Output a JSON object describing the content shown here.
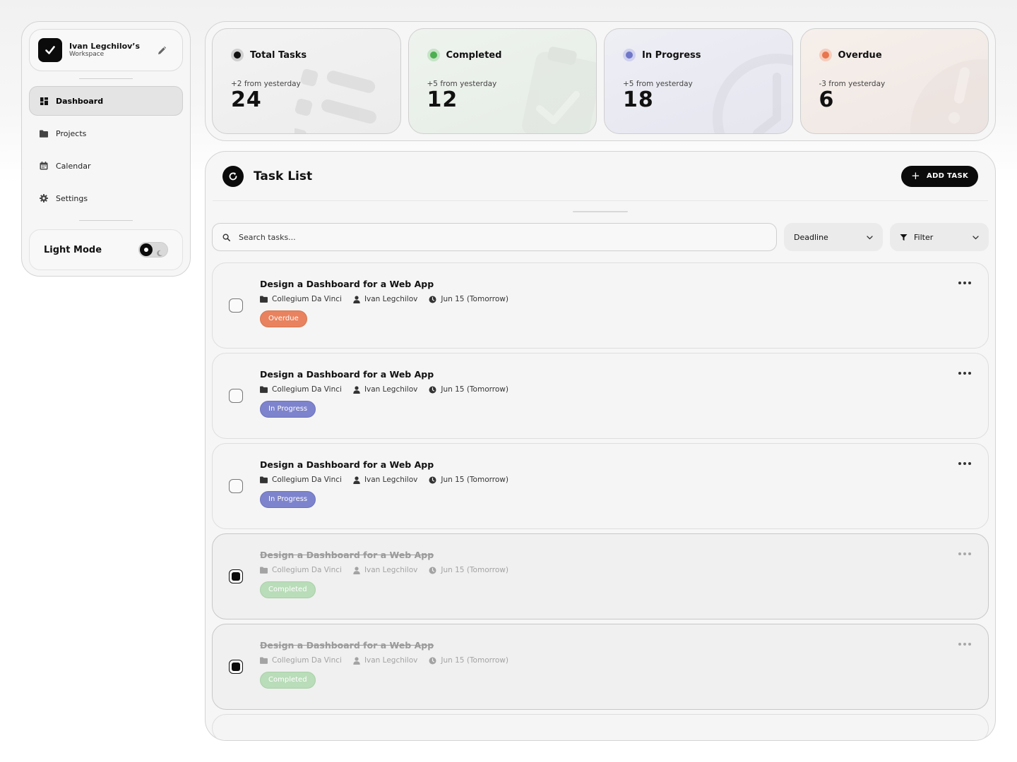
{
  "workspace": {
    "name": "Ivan Legchilov’s",
    "subtitle": "Workspace"
  },
  "nav": [
    {
      "label": "Dashboard",
      "icon": "dashboard-icon",
      "active": true
    },
    {
      "label": "Projects",
      "icon": "folder-icon",
      "active": false
    },
    {
      "label": "Calendar",
      "icon": "calendar-icon",
      "active": false
    },
    {
      "label": "Settings",
      "icon": "gear-icon",
      "active": false
    }
  ],
  "mode": {
    "label": "Light Mode"
  },
  "stats": [
    {
      "label": "Total Tasks",
      "delta": "+2 from yesterday",
      "value": "24",
      "color": "#111111"
    },
    {
      "label": "Completed",
      "delta": "+5 from yesterday",
      "value": "12",
      "color": "#4caf50"
    },
    {
      "label": "In Progress",
      "delta": "+5 from yesterday",
      "value": "18",
      "color": "#7077c9"
    },
    {
      "label": "Overdue",
      "delta": "-3 from yesterday",
      "value": "6",
      "color": "#e8754d"
    }
  ],
  "task_list": {
    "title": "Task List",
    "add_label": "ADD TASK",
    "search_placeholder": "Search tasks...",
    "sort_label": "Deadline",
    "filter_label": "Filter"
  },
  "tasks": [
    {
      "title": "Design a Dashboard for a Web App",
      "project": "Collegium Da Vinci",
      "assignee": "Ivan Legchilov",
      "due": "Jun 15 (Tomorrow)",
      "status": "Overdue",
      "done": false
    },
    {
      "title": "Design a Dashboard for a Web App",
      "project": "Collegium Da Vinci",
      "assignee": "Ivan Legchilov",
      "due": "Jun 15 (Tomorrow)",
      "status": "In Progress",
      "done": false
    },
    {
      "title": "Design a Dashboard for a Web App",
      "project": "Collegium Da Vinci",
      "assignee": "Ivan Legchilov",
      "due": "Jun 15 (Tomorrow)",
      "status": "In Progress",
      "done": false
    },
    {
      "title": "Design a Dashboard for a Web App",
      "project": "Collegium Da Vinci",
      "assignee": "Ivan Legchilov",
      "due": "Jun 15 (Tomorrow)",
      "status": "Completed",
      "done": true
    },
    {
      "title": "Design a Dashboard for a Web App",
      "project": "Collegium Da Vinci",
      "assignee": "Ivan Legchilov",
      "due": "Jun 15 (Tomorrow)",
      "status": "Completed",
      "done": true
    }
  ]
}
